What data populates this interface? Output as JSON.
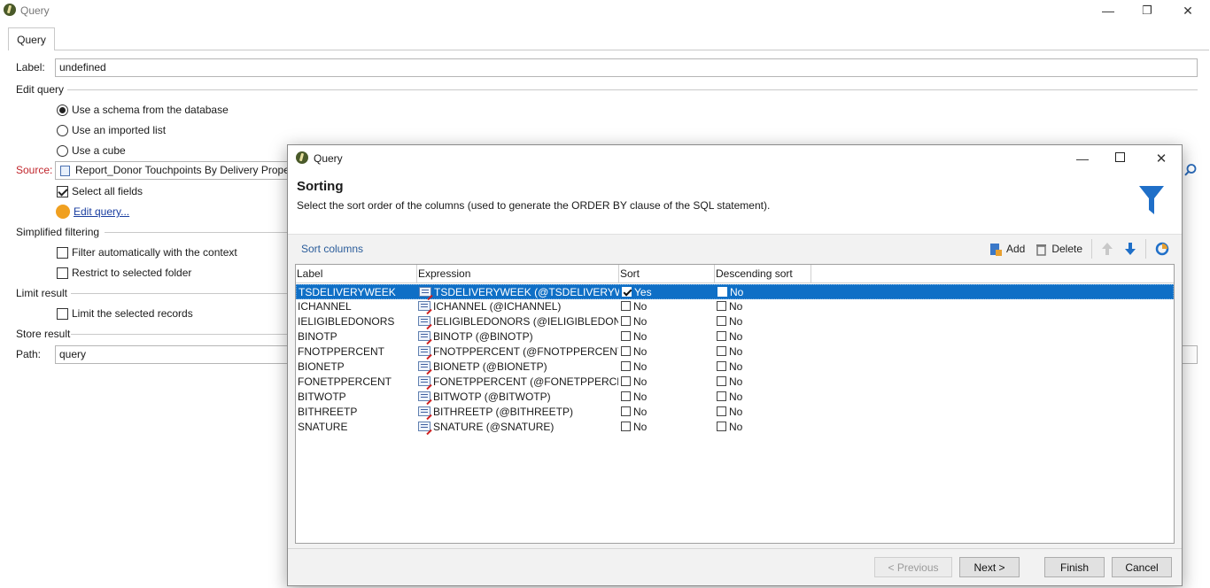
{
  "window": {
    "title": "Query",
    "minimize": "—",
    "restore": "❐",
    "close": "✕"
  },
  "tabs": [
    {
      "label": "Query"
    }
  ],
  "form": {
    "label_caption": "Label:",
    "label_value": "undefined",
    "edit_query_section": "Edit query",
    "options": {
      "schema": "Use a schema from the database",
      "imported": "Use an imported list",
      "cube": "Use a cube"
    },
    "source_caption": "Source:",
    "source_value": "Report_Donor Touchpoints By Delivery Proper",
    "select_all": "Select all fields",
    "edit_query_link": "Edit query...",
    "simplified_section": "Simplified filtering",
    "filter_context": "Filter automatically with the context",
    "restrict_folder": "Restrict to selected folder",
    "limit_section": "Limit result",
    "limit_records": "Limit the selected records",
    "store_section": "Store result",
    "path_caption": "Path:",
    "path_value": "query"
  },
  "dialog": {
    "title": "Query",
    "heading": "Sorting",
    "description": "Select the sort order of the columns (used to generate the ORDER BY clause of the SQL statement).",
    "toolbar": {
      "section": "Sort columns",
      "add": "Add",
      "delete": "Delete"
    },
    "columns": [
      "Label",
      "Expression",
      "Sort",
      "Descending sort"
    ],
    "rows": [
      {
        "label": "TSDELIVERYWEEK",
        "expression": "TSDELIVERYWEEK (@TSDELIVERYWEEK)",
        "sort": "Yes",
        "desc": "No"
      },
      {
        "label": "ICHANNEL",
        "expression": "ICHANNEL (@ICHANNEL)",
        "sort": "No",
        "desc": "No"
      },
      {
        "label": "IELIGIBLEDONORS",
        "expression": "IELIGIBLEDONORS (@IELIGIBLEDONOR...",
        "sort": "No",
        "desc": "No"
      },
      {
        "label": "BINOTP",
        "expression": "BINOTP (@BINOTP)",
        "sort": "No",
        "desc": "No"
      },
      {
        "label": "FNOTPPERCENT",
        "expression": "FNOTPPERCENT (@FNOTPPERCENT)",
        "sort": "No",
        "desc": "No"
      },
      {
        "label": "BIONETP",
        "expression": "BIONETP (@BIONETP)",
        "sort": "No",
        "desc": "No"
      },
      {
        "label": "FONETPPERCENT",
        "expression": "FONETPPERCENT (@FONETPPERCENT)",
        "sort": "No",
        "desc": "No"
      },
      {
        "label": "BITWOTP",
        "expression": "BITWOTP (@BITWOTP)",
        "sort": "No",
        "desc": "No"
      },
      {
        "label": "BITHREETP",
        "expression": "BITHREETP (@BITHREETP)",
        "sort": "No",
        "desc": "No"
      },
      {
        "label": "SNATURE",
        "expression": "SNATURE (@SNATURE)",
        "sort": "No",
        "desc": "No"
      }
    ],
    "buttons": {
      "previous": "< Previous",
      "next": "Next >",
      "finish": "Finish",
      "cancel": "Cancel"
    }
  },
  "colors": {
    "selection": "#0f6fc6",
    "accent_blue": "#1f6fc8",
    "required_red": "#c1272d"
  }
}
